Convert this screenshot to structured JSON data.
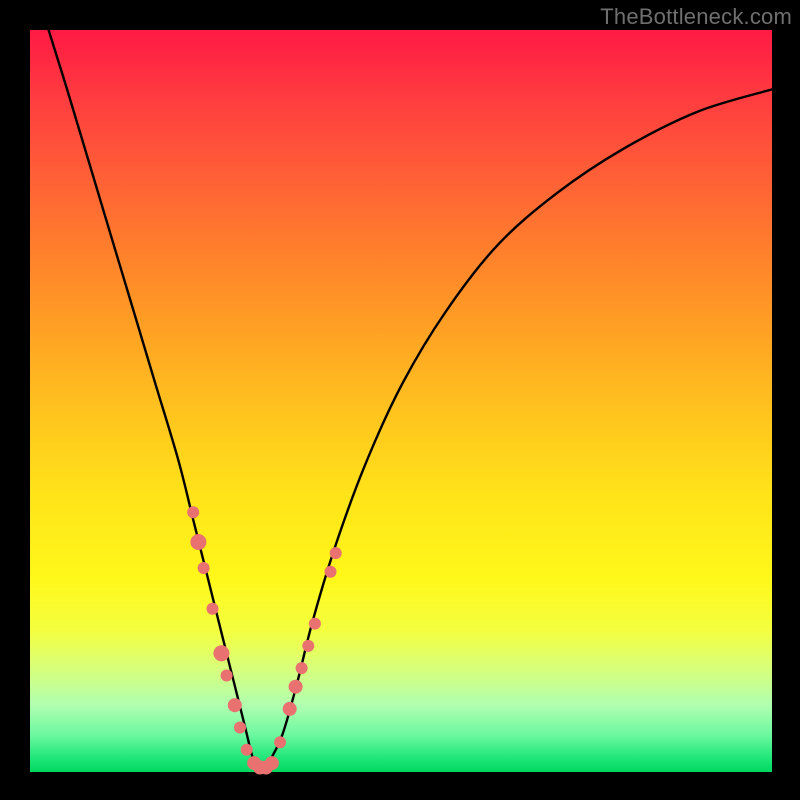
{
  "watermark": "TheBottleneck.com",
  "colors": {
    "frame": "#000000",
    "curve": "#000000",
    "marker_fill": "#e9716f",
    "marker_stroke": "#d85f5d"
  },
  "chart_data": {
    "type": "line",
    "title": "",
    "xlabel": "",
    "ylabel": "",
    "xlim": [
      0,
      100
    ],
    "ylim": [
      0,
      100
    ],
    "grid": false,
    "legend": false,
    "note": "Axes are unlabeled in the image; x and y are read as 0–100 percent of plot width/height. y=0 is the bottom (green) edge.",
    "series": [
      {
        "name": "bottleneck-curve",
        "x": [
          2.5,
          5,
          8,
          11,
          14,
          17,
          20,
          22,
          24,
          26,
          27.5,
          29,
          30,
          31,
          32,
          34,
          36,
          38,
          41,
          45,
          50,
          56,
          63,
          71,
          80,
          90,
          100
        ],
        "y": [
          100,
          92,
          82,
          72,
          62,
          52,
          42,
          34,
          26,
          18,
          12,
          6,
          2,
          0,
          1,
          5,
          12,
          20,
          30,
          41,
          52,
          62,
          71,
          78,
          84,
          89,
          92
        ]
      }
    ],
    "markers": {
      "name": "highlighted-points",
      "note": "Pink dots clustered around the valley of the curve.",
      "points": [
        {
          "x": 22.0,
          "y": 35.0,
          "r": 6
        },
        {
          "x": 22.7,
          "y": 31.0,
          "r": 8
        },
        {
          "x": 23.4,
          "y": 27.5,
          "r": 6
        },
        {
          "x": 24.6,
          "y": 22.0,
          "r": 6
        },
        {
          "x": 25.8,
          "y": 16.0,
          "r": 8
        },
        {
          "x": 26.5,
          "y": 13.0,
          "r": 6
        },
        {
          "x": 27.6,
          "y": 9.0,
          "r": 7
        },
        {
          "x": 28.3,
          "y": 6.0,
          "r": 6
        },
        {
          "x": 29.2,
          "y": 3.0,
          "r": 6
        },
        {
          "x": 30.2,
          "y": 1.2,
          "r": 7
        },
        {
          "x": 31.0,
          "y": 0.6,
          "r": 7
        },
        {
          "x": 31.8,
          "y": 0.6,
          "r": 7
        },
        {
          "x": 32.6,
          "y": 1.2,
          "r": 7
        },
        {
          "x": 33.7,
          "y": 4.0,
          "r": 6
        },
        {
          "x": 35.0,
          "y": 8.5,
          "r": 7
        },
        {
          "x": 35.8,
          "y": 11.5,
          "r": 7
        },
        {
          "x": 36.6,
          "y": 14.0,
          "r": 6
        },
        {
          "x": 37.5,
          "y": 17.0,
          "r": 6
        },
        {
          "x": 38.4,
          "y": 20.0,
          "r": 6
        },
        {
          "x": 40.5,
          "y": 27.0,
          "r": 6
        },
        {
          "x": 41.2,
          "y": 29.5,
          "r": 6
        }
      ]
    }
  }
}
